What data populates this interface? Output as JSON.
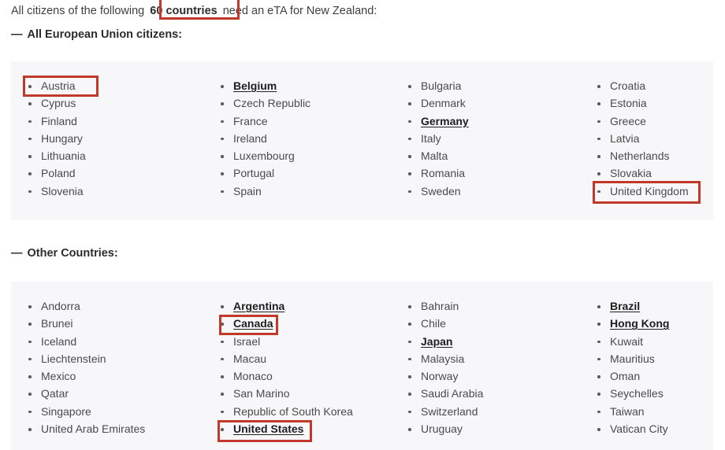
{
  "intro": {
    "before": "All citizens of the following ",
    "highlight": "60 countries",
    "after": " need an eTA for New Zealand:"
  },
  "sections": [
    {
      "id": "eu",
      "dash": "—",
      "heading": "All European Union citizens:",
      "columns": [
        {
          "items": [
            {
              "name": "Austria",
              "strong": false
            },
            {
              "name": "Cyprus",
              "strong": false
            },
            {
              "name": "Finland",
              "strong": false
            },
            {
              "name": "Hungary",
              "strong": false
            },
            {
              "name": "Lithuania",
              "strong": false
            },
            {
              "name": "Poland",
              "strong": false
            },
            {
              "name": "Slovenia",
              "strong": false
            }
          ]
        },
        {
          "items": [
            {
              "name": "Belgium",
              "strong": true
            },
            {
              "name": "Czech Republic",
              "strong": false
            },
            {
              "name": "France",
              "strong": false
            },
            {
              "name": "Ireland",
              "strong": false
            },
            {
              "name": "Luxembourg",
              "strong": false
            },
            {
              "name": "Portugal",
              "strong": false
            },
            {
              "name": "Spain",
              "strong": false
            }
          ]
        },
        {
          "items": [
            {
              "name": "Bulgaria",
              "strong": false
            },
            {
              "name": "Denmark",
              "strong": false
            },
            {
              "name": "Germany",
              "strong": true
            },
            {
              "name": "Italy",
              "strong": false
            },
            {
              "name": "Malta",
              "strong": false
            },
            {
              "name": "Romania",
              "strong": false
            },
            {
              "name": "Sweden",
              "strong": false
            }
          ]
        },
        {
          "items": [
            {
              "name": "Croatia",
              "strong": false
            },
            {
              "name": "Estonia",
              "strong": false
            },
            {
              "name": "Greece",
              "strong": false
            },
            {
              "name": "Latvia",
              "strong": false
            },
            {
              "name": "Netherlands",
              "strong": false
            },
            {
              "name": "Slovakia",
              "strong": false
            },
            {
              "name": "United Kingdom",
              "strong": false
            }
          ]
        }
      ]
    },
    {
      "id": "other",
      "dash": "—",
      "heading": "Other Countries:",
      "columns": [
        {
          "items": [
            {
              "name": "Andorra",
              "strong": false
            },
            {
              "name": "Brunei",
              "strong": false
            },
            {
              "name": "Iceland",
              "strong": false
            },
            {
              "name": "Liechtenstein",
              "strong": false
            },
            {
              "name": "Mexico",
              "strong": false
            },
            {
              "name": "Qatar",
              "strong": false
            },
            {
              "name": "Singapore",
              "strong": false
            },
            {
              "name": "United Arab Emirates",
              "strong": false
            }
          ]
        },
        {
          "items": [
            {
              "name": "Argentina",
              "strong": true
            },
            {
              "name": "Canada",
              "strong": true
            },
            {
              "name": "Israel",
              "strong": false
            },
            {
              "name": "Macau",
              "strong": false
            },
            {
              "name": "Monaco",
              "strong": false
            },
            {
              "name": "San Marino",
              "strong": false
            },
            {
              "name": "Republic of South Korea",
              "strong": false
            },
            {
              "name": "United States",
              "strong": true
            }
          ]
        },
        {
          "items": [
            {
              "name": "Bahrain",
              "strong": false
            },
            {
              "name": "Chile",
              "strong": false
            },
            {
              "name": "Japan",
              "strong": true
            },
            {
              "name": "Malaysia",
              "strong": false
            },
            {
              "name": "Norway",
              "strong": false
            },
            {
              "name": "Saudi Arabia",
              "strong": false
            },
            {
              "name": "Switzerland",
              "strong": false
            },
            {
              "name": "Uruguay",
              "strong": false
            }
          ]
        },
        {
          "items": [
            {
              "name": "Brazil",
              "strong": true
            },
            {
              "name": "Hong Kong",
              "strong": true
            },
            {
              "name": "Kuwait",
              "strong": false
            },
            {
              "name": "Mauritius",
              "strong": false
            },
            {
              "name": "Oman",
              "strong": false
            },
            {
              "name": "Seychelles",
              "strong": false
            },
            {
              "name": "Taiwan",
              "strong": false
            },
            {
              "name": "Vatican City",
              "strong": false
            }
          ]
        }
      ]
    }
  ],
  "annotations": {
    "color": "#c0392b",
    "boxes": [
      {
        "id": "box-60countries",
        "target": "60 countries"
      },
      {
        "id": "box-austria",
        "target": "Austria"
      },
      {
        "id": "box-uk",
        "target": "United Kingdom"
      },
      {
        "id": "box-canada",
        "target": "Canada"
      },
      {
        "id": "box-unitedstates",
        "target": "United States"
      }
    ]
  },
  "colors": {
    "panel_background": "#f7f7f9",
    "page_background": "#ffffff",
    "text": "#4a4a4a",
    "annotation": "#c0392b"
  }
}
